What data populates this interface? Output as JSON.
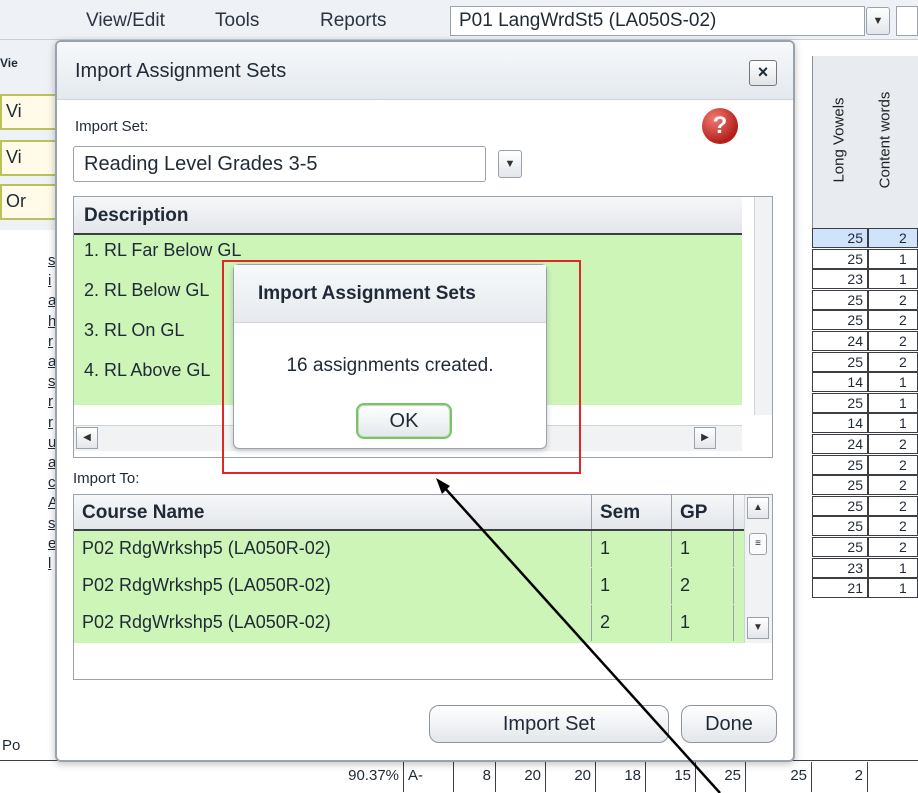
{
  "menubar": {
    "items": [
      "View/Edit",
      "Tools",
      "Reports"
    ],
    "course_value": "P01  LangWrdSt5 (LA050S-02)"
  },
  "left_tabs": [
    "Vie",
    "Vi",
    "Vi",
    "Or"
  ],
  "left_letters": [
    "s",
    "i",
    "a",
    "h",
    "r",
    "a",
    "s",
    "r",
    "r",
    "u",
    "a",
    "c",
    "A",
    "s",
    "e",
    "l"
  ],
  "grid": {
    "headers": [
      "Long Vowels",
      "Content words"
    ],
    "rows": [
      [
        "25",
        "2"
      ],
      [
        "25",
        "1"
      ],
      [
        "23",
        "1"
      ],
      [
        "25",
        "2"
      ],
      [
        "25",
        "2"
      ],
      [
        "24",
        "2"
      ],
      [
        "25",
        "2"
      ],
      [
        "14",
        "1"
      ],
      [
        "25",
        "1"
      ],
      [
        "14",
        "1"
      ],
      [
        "24",
        "2"
      ],
      [
        "25",
        "2"
      ],
      [
        "25",
        "2"
      ],
      [
        "25",
        "2"
      ],
      [
        "25",
        "2"
      ],
      [
        "25",
        "2"
      ],
      [
        "23",
        "1"
      ],
      [
        "21",
        "1"
      ]
    ]
  },
  "bottom_row": {
    "left_label": "Po",
    "percent": "90.37%",
    "grade": "A-",
    "values": [
      "8",
      "20",
      "20",
      "18",
      "15",
      "25",
      "25",
      "2"
    ]
  },
  "dialog": {
    "title": "Import Assignment Sets",
    "close_label": "×",
    "import_set_label": "Import Set:",
    "import_set_value": "Reading Level Grades 3-5",
    "help_label": "?",
    "description_header": "Description",
    "descriptions": [
      "1. RL Far Below GL",
      "2. RL Below GL",
      "3. RL On GL",
      "4. RL Above GL"
    ],
    "import_to_label": "Import To:",
    "columns": {
      "course": "Course Name",
      "sem": "Sem",
      "gp": "GP"
    },
    "courses": [
      {
        "name": "P02  RdgWrkshp5 (LA050R-02)",
        "sem": "1",
        "gp": "1"
      },
      {
        "name": "P02  RdgWrkshp5 (LA050R-02)",
        "sem": "1",
        "gp": "2"
      },
      {
        "name": "P02  RdgWrkshp5 (LA050R-02)",
        "sem": "2",
        "gp": "1"
      }
    ],
    "import_button": "Import Set",
    "done_button": "Done"
  },
  "message_box": {
    "title": "Import Assignment Sets",
    "text": "16 assignments created.",
    "ok_label": "OK"
  },
  "colors": {
    "row_green": "#cdf5b8",
    "highlight": "#e0262b",
    "help": "#b4201a"
  }
}
